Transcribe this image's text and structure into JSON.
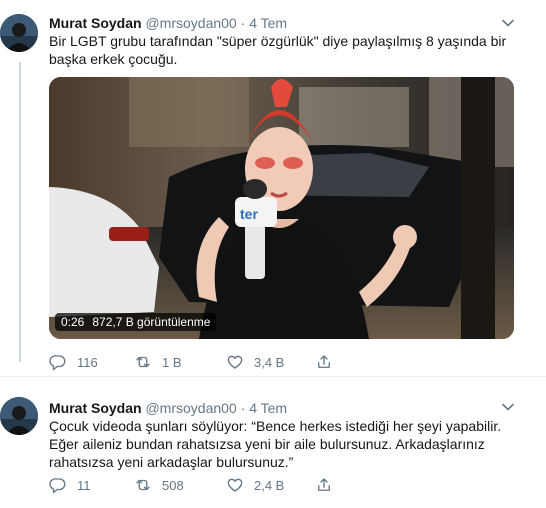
{
  "tweets": [
    {
      "author_name": "Murat Soydan",
      "author_handle": "@mrsoydan00",
      "separator": "·",
      "time": "4 Tem",
      "text": "Bir LGBT grubu tarafından \"süper özgürlük\" diye paylaşılmış 8 yaşında bir başka erkek çocuğu.",
      "video": {
        "duration": "0:26",
        "views": "872,7 B görüntülenme",
        "mic_text": "ter"
      },
      "actions": {
        "reply_count": "116",
        "retweet_count": "1 B",
        "like_count": "3,4 B"
      }
    },
    {
      "author_name": "Murat Soydan",
      "author_handle": "@mrsoydan00",
      "separator": "·",
      "time": "4 Tem",
      "text": "Çocuk videoda şunları söylüyor: “Bence herkes istediği her şeyi yapabilir. Eğer aileniz bundan rahatsızsa yeni bir aile bulursunuz. Arkadaşlarınız rahatsızsa yeni arkadaşlar bulursunuz.”",
      "actions": {
        "reply_count": "11",
        "retweet_count": "508",
        "like_count": "2,4 B"
      }
    }
  ],
  "icons": {
    "reply": "reply-icon",
    "retweet": "retweet-icon",
    "like": "heart-icon",
    "share": "share-icon",
    "more": "chevron-down-icon"
  },
  "colors": {
    "text": "#14171a",
    "secondary": "#657786",
    "divider": "#e6ecf0"
  }
}
